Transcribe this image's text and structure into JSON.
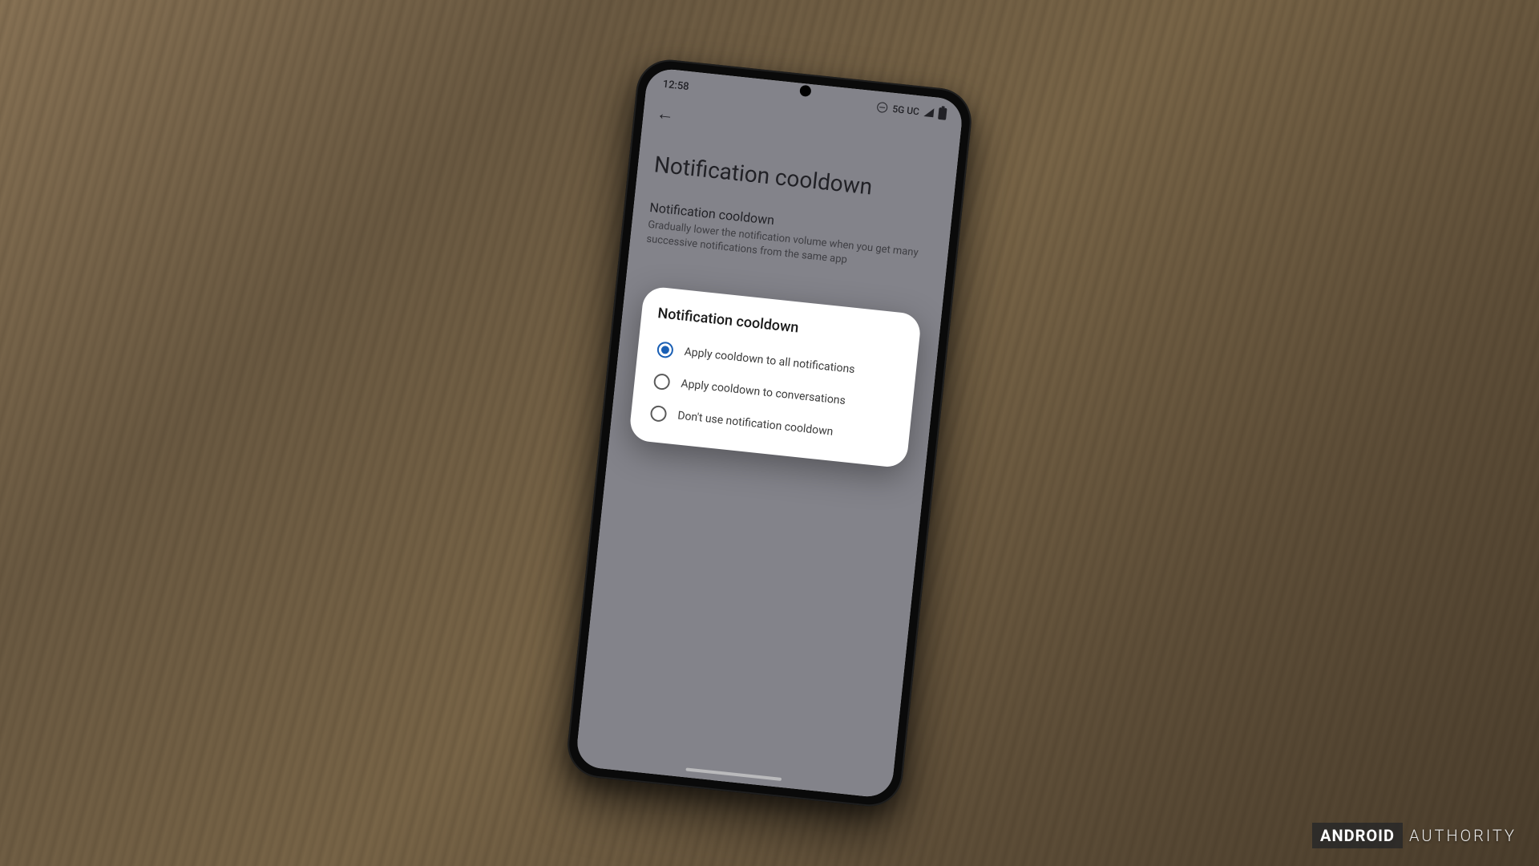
{
  "status_bar": {
    "time": "12:58",
    "network_label": "5G UC"
  },
  "page": {
    "title": "Notification cooldown",
    "setting_name": "Notification cooldown",
    "setting_description": "Gradually lower the notification volume when you get many successive notifications from the same app"
  },
  "dialog": {
    "title": "Notification cooldown",
    "options": [
      {
        "label": "Apply cooldown to all notifications",
        "selected": true
      },
      {
        "label": "Apply cooldown to conversations",
        "selected": false
      },
      {
        "label": "Don't use notification cooldown",
        "selected": false
      }
    ]
  },
  "watermark": {
    "brand_box": "ANDROID",
    "brand_text": "AUTHORITY"
  }
}
